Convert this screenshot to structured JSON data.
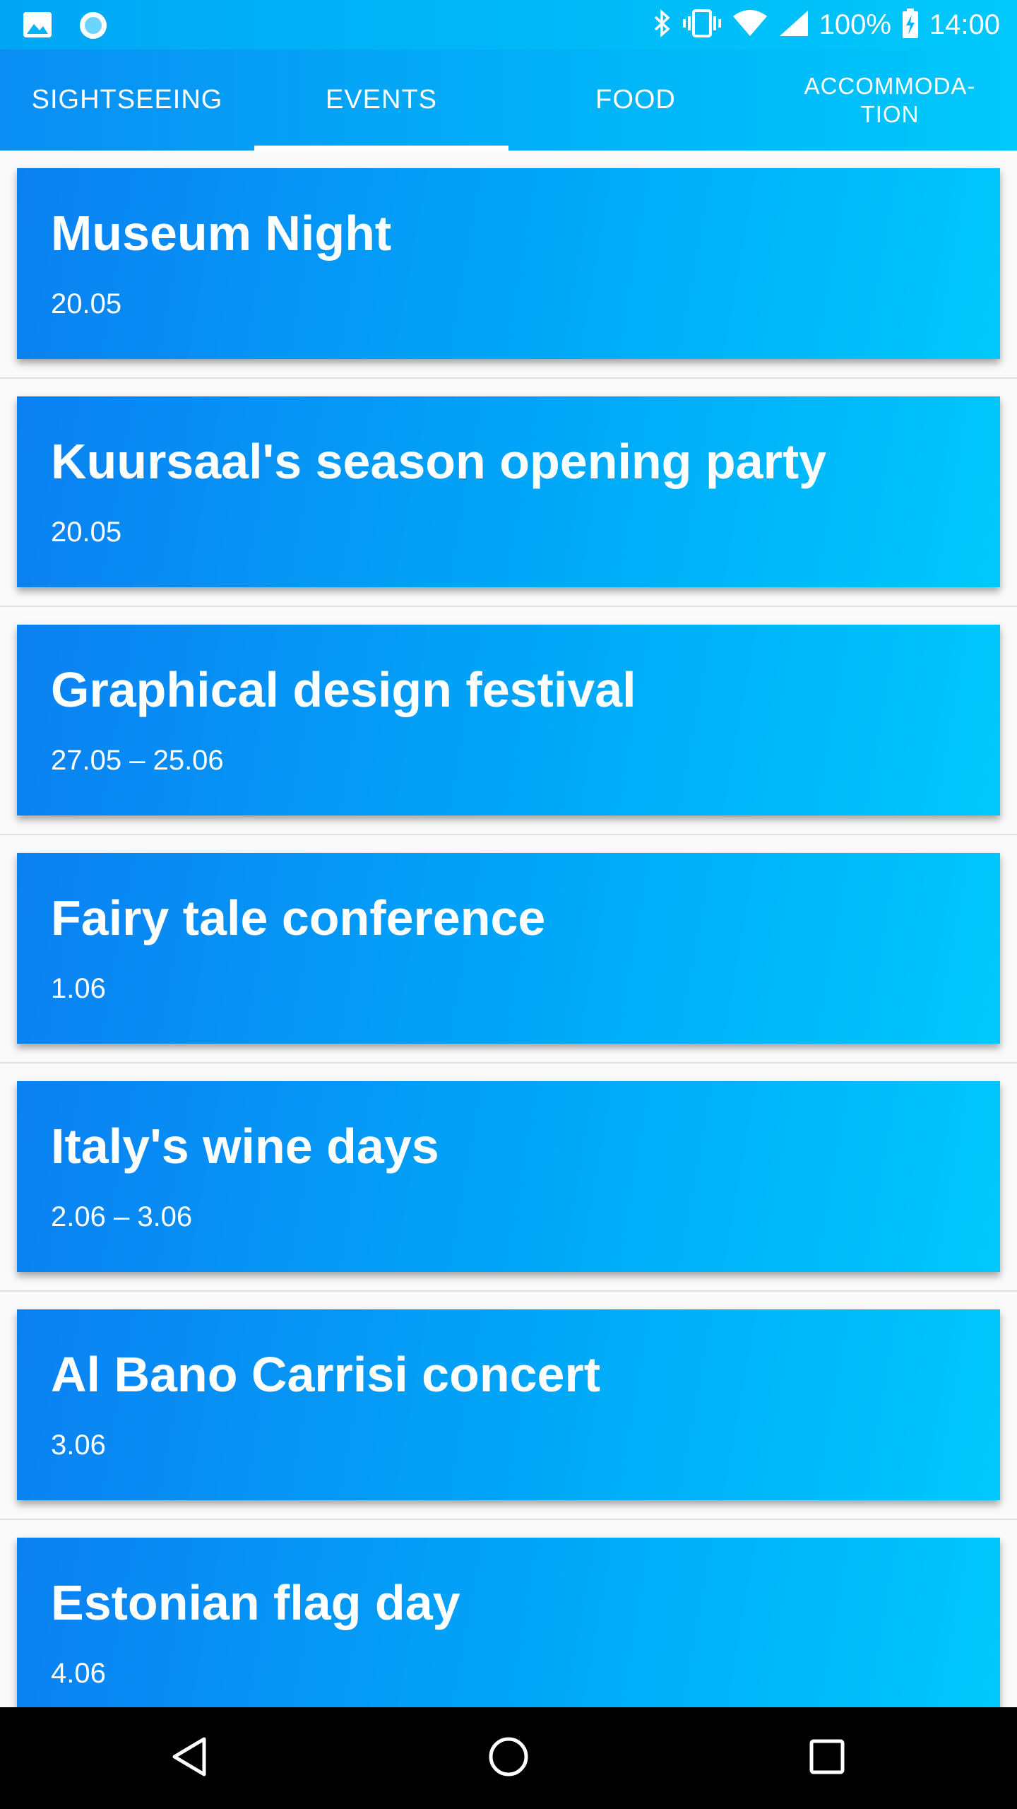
{
  "status_bar": {
    "battery": "100%",
    "time": "14:00",
    "icons": [
      "image-icon",
      "circle-notification-icon",
      "bluetooth-icon",
      "vibrate-icon",
      "wifi-icon",
      "signal-icon",
      "battery-charging-icon"
    ]
  },
  "tabs": [
    {
      "label": "SIGHTSEEING",
      "active": false
    },
    {
      "label": "EVENTS",
      "active": true
    },
    {
      "label": "FOOD",
      "active": false
    },
    {
      "label": "ACCOMMODA-\nTION",
      "active": false
    }
  ],
  "events": [
    {
      "title": "Museum Night",
      "date": "20.05"
    },
    {
      "title": "Kuursaal's season opening party",
      "date": "20.05"
    },
    {
      "title": "Graphical design festival",
      "date": "27.05 – 25.06"
    },
    {
      "title": "Fairy tale conference",
      "date": "1.06"
    },
    {
      "title": "Italy's wine days",
      "date": "2.06 – 3.06"
    },
    {
      "title": "Al Bano Carrisi concert",
      "date": "3.06"
    },
    {
      "title": "Estonian flag day",
      "date": "4.06"
    }
  ],
  "nav_bar": {
    "icons": [
      "back-icon",
      "home-icon",
      "recents-icon"
    ]
  },
  "colors": {
    "accent_start": "#0b80f2",
    "accent_end": "#00c8fc",
    "background": "#fafafa",
    "nav_bar": "#000000"
  }
}
